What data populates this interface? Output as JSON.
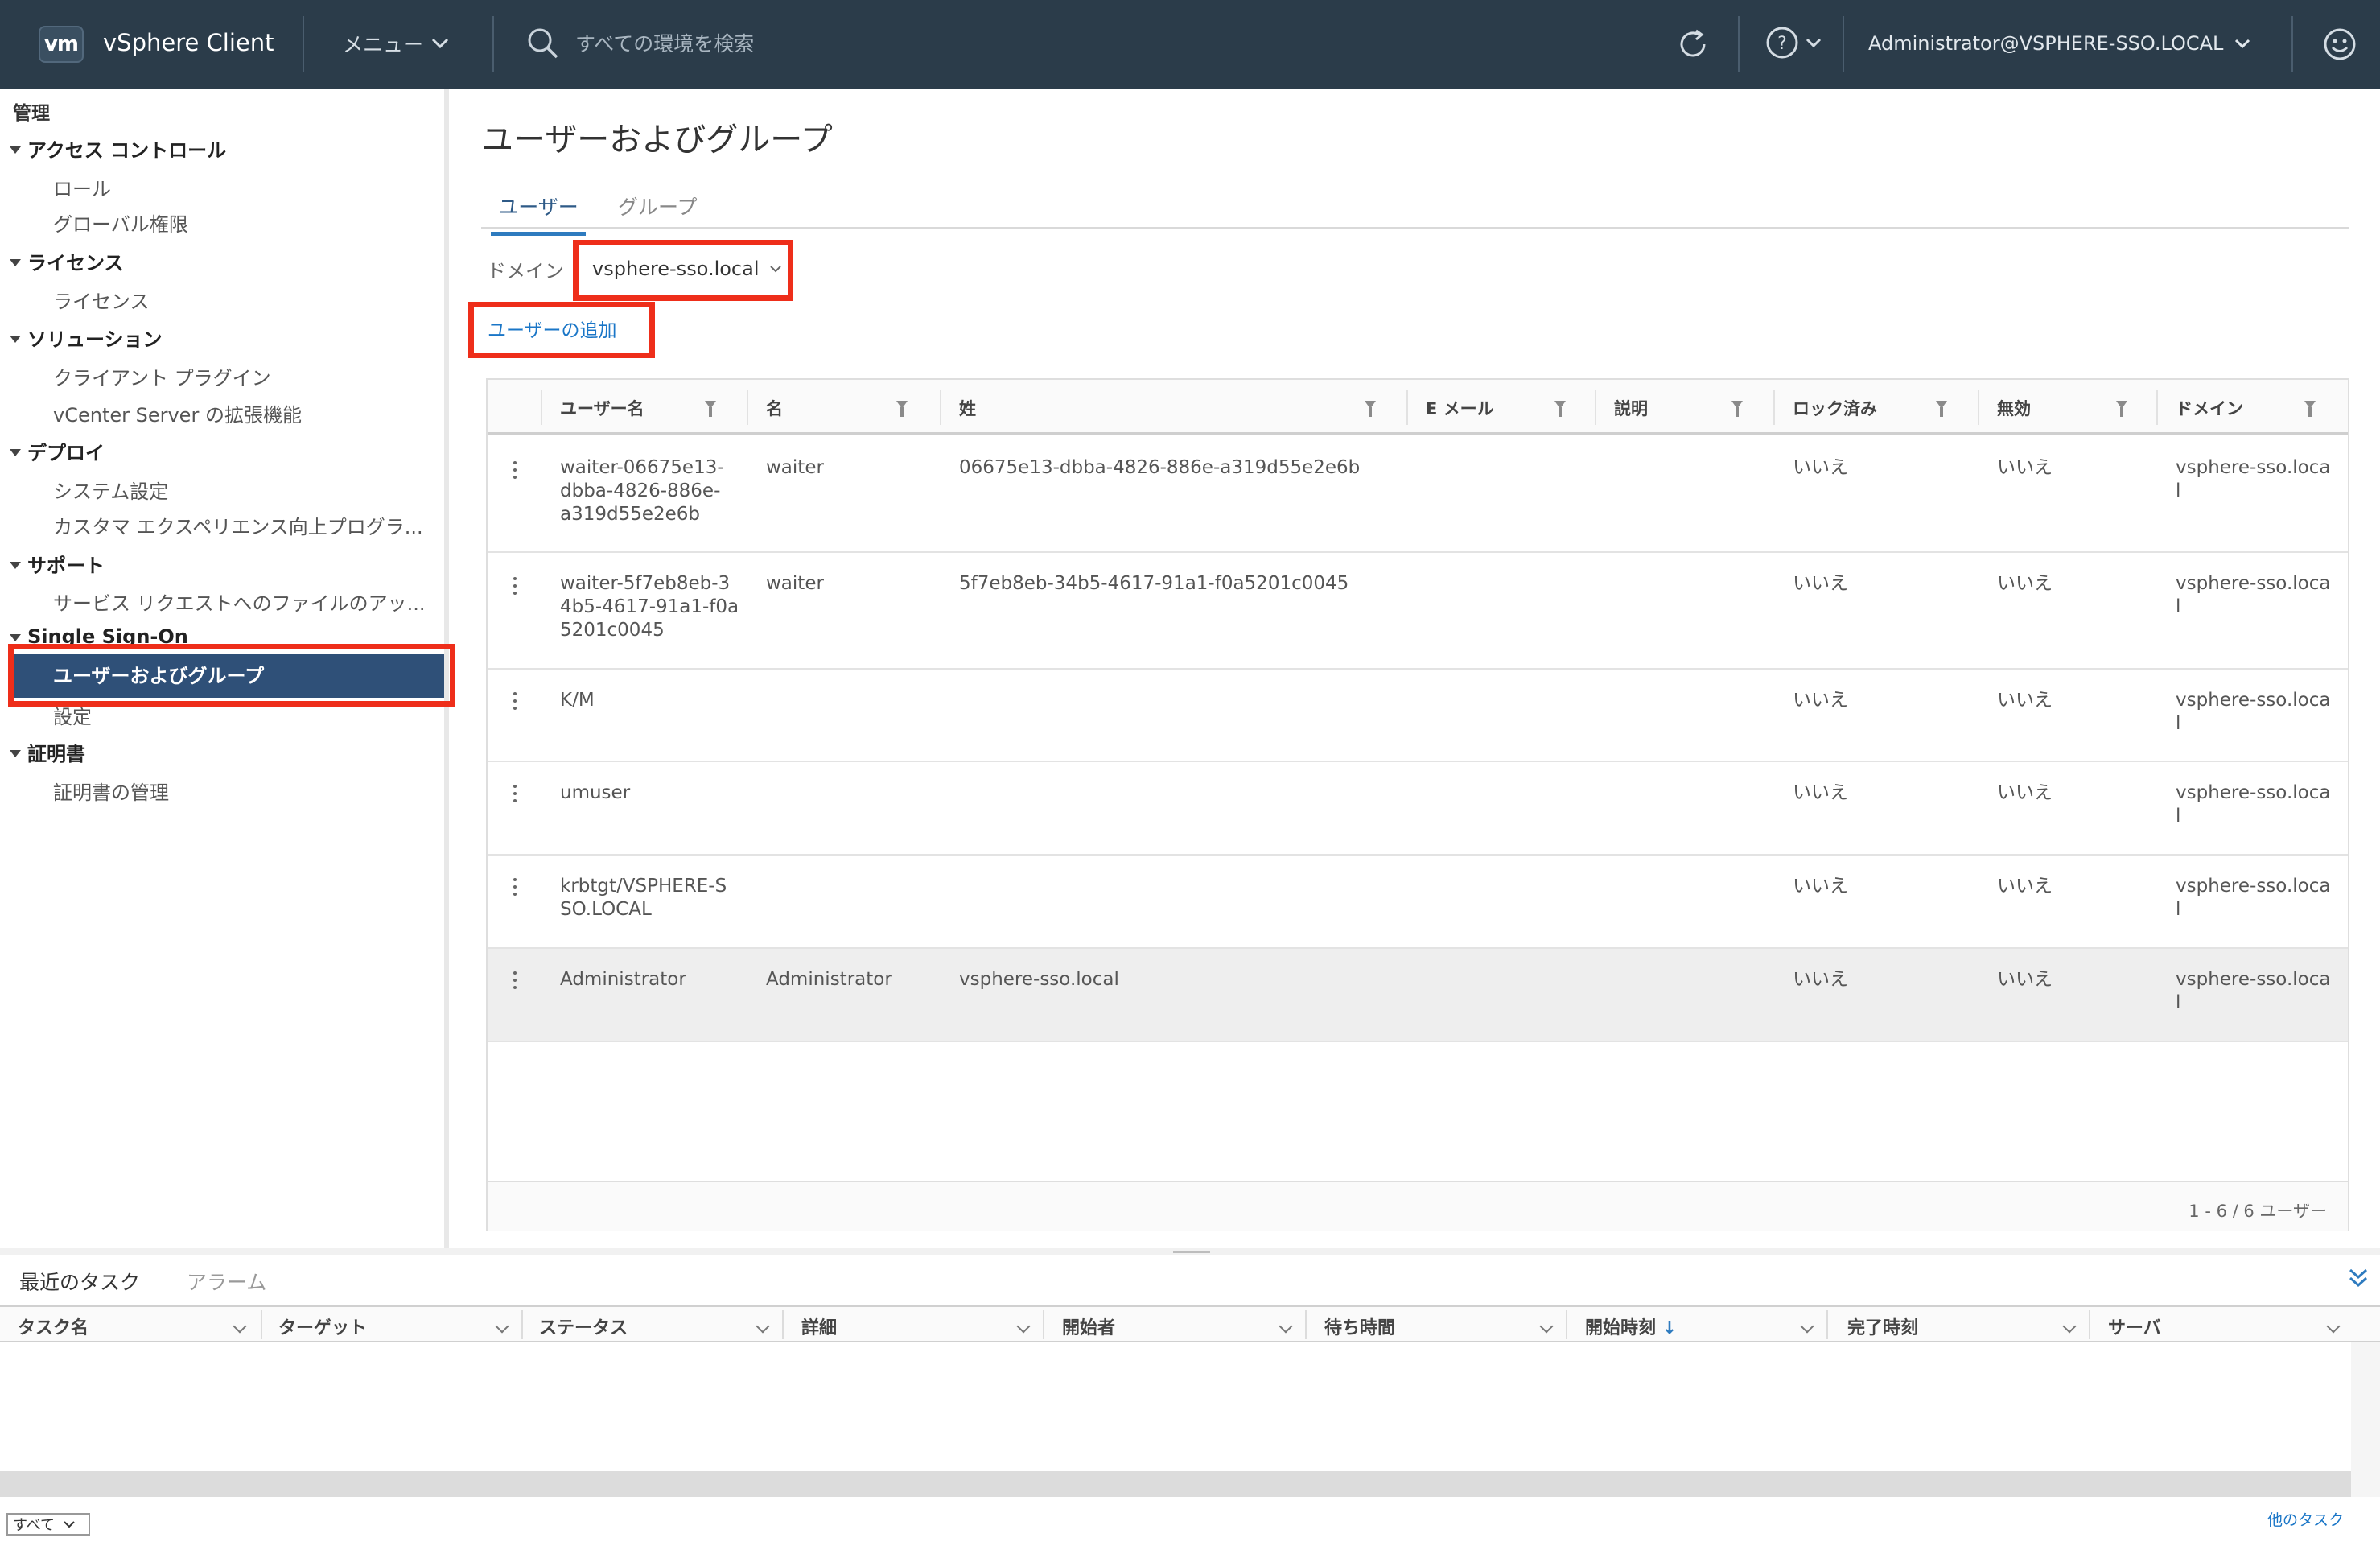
{
  "header": {
    "logo": "vm",
    "app_title": "vSphere Client",
    "menu_label": "メニュー",
    "search_placeholder": "すべての環境を検索",
    "user": "Administrator@VSPHERE-SSO.LOCAL"
  },
  "sidebar": {
    "title": "管理",
    "sections": [
      {
        "label": "アクセス コントロール",
        "items": [
          "ロール",
          "グローバル権限"
        ]
      },
      {
        "label": "ライセンス",
        "items": [
          "ライセンス"
        ]
      },
      {
        "label": "ソリューション",
        "items": [
          "クライアント プラグイン",
          "vCenter Server の拡張機能"
        ]
      },
      {
        "label": "デプロイ",
        "items": [
          "システム設定",
          "カスタマ エクスペリエンス向上プログラ..."
        ]
      },
      {
        "label": "サポート",
        "items": [
          "サービス リクエストへのファイルのアッ..."
        ]
      },
      {
        "label": "Single Sign-On",
        "items": [
          "ユーザーおよびグループ",
          "設定"
        ]
      },
      {
        "label": "証明書",
        "items": [
          "証明書の管理"
        ]
      }
    ]
  },
  "main": {
    "title": "ユーザーおよびグループ",
    "tabs": [
      "ユーザー",
      "グループ"
    ],
    "domain_label": "ドメイン",
    "domain_value": "vsphere-sso.local",
    "add_user": "ユーザーの追加",
    "columns": [
      "ユーザー名",
      "名",
      "姓",
      "E メール",
      "説明",
      "ロック済み",
      "無効",
      "ドメイン"
    ],
    "rows": [
      {
        "username": "waiter-06675e13-\ndbba-4826-886e-\na319d55e2e6b",
        "first": "waiter",
        "last": "06675e13-dbba-4826-886e-a319d55e2e6b",
        "email": "",
        "desc": "",
        "locked": "いいえ",
        "disabled": "いいえ",
        "domain": "vsphere-sso.loca\nl"
      },
      {
        "username": "waiter-5f7eb8eb-3\n4b5-4617-91a1-f0a\n5201c0045",
        "first": "waiter",
        "last": "5f7eb8eb-34b5-4617-91a1-f0a5201c0045",
        "email": "",
        "desc": "",
        "locked": "いいえ",
        "disabled": "いいえ",
        "domain": "vsphere-sso.loca\nl"
      },
      {
        "username": "K/M",
        "first": "",
        "last": "",
        "email": "",
        "desc": "",
        "locked": "いいえ",
        "disabled": "いいえ",
        "domain": "vsphere-sso.loca\nl"
      },
      {
        "username": "umuser",
        "first": "",
        "last": "",
        "email": "",
        "desc": "",
        "locked": "いいえ",
        "disabled": "いいえ",
        "domain": "vsphere-sso.loca\nl"
      },
      {
        "username": "krbtgt/VSPHERE-S\nSO.LOCAL",
        "first": "",
        "last": "",
        "email": "",
        "desc": "",
        "locked": "いいえ",
        "disabled": "いいえ",
        "domain": "vsphere-sso.loca\nl"
      },
      {
        "username": "Administrator",
        "first": "Administrator",
        "last": "vsphere-sso.local",
        "email": "",
        "desc": "",
        "locked": "いいえ",
        "disabled": "いいえ",
        "domain": "vsphere-sso.loca\nl",
        "selected": true
      }
    ],
    "footer_count": "1 - 6 / 6 ユーザー"
  },
  "tasks": {
    "tabs": [
      "最近のタスク",
      "アラーム"
    ],
    "columns": [
      "タスク名",
      "ターゲット",
      "ステータス",
      "詳細",
      "開始者",
      "待ち時間",
      "開始時刻",
      "完了時刻",
      "サーバ"
    ],
    "filter_value": "すべて",
    "more_link": "他のタスク"
  },
  "colors": {
    "header_bg": "#2b3c4a",
    "accent": "#2e7bbf",
    "active_nav": "#2f5078",
    "highlight": "#ee2e1a"
  }
}
